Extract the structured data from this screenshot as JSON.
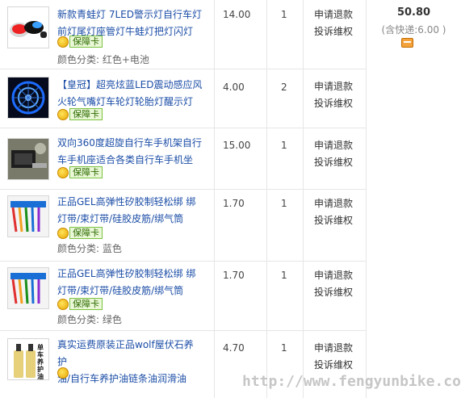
{
  "orders": [
    {
      "title": "新款青蛙灯 7LED警示灯自行车灯前灯尾灯座管灯牛蛙灯把灯闪灯",
      "title_lines": [
        "新款青蛙灯 7LED警示灯自行车灯",
        "前灯尾灯座管灯牛蛙灯把灯闪灯"
      ],
      "badge": "保障卡",
      "variant": "颜色分类: 红色+电池",
      "price": "14.00",
      "qty": "1",
      "actions": [
        "申请退款",
        "投诉维权"
      ]
    },
    {
      "title_lines": [
        "【皇冠】超亮炫蓝LED震动感应风",
        "火轮气嘴灯车轮灯轮胎灯醒示灯"
      ],
      "badge": "保障卡",
      "variant": "",
      "price": "4.00",
      "qty": "2",
      "actions": [
        "申请退款",
        "投诉维权"
      ]
    },
    {
      "title_lines": [
        "双向360度超旋自行车手机架自行",
        "车手机座适合各类自行车手机坐"
      ],
      "badge": "保障卡",
      "variant": "",
      "price": "15.00",
      "qty": "1",
      "actions": [
        "申请退款",
        "投诉维权"
      ]
    },
    {
      "title_lines": [
        "正品GEL高弹性矽胶制轻松绑 绑",
        "灯带/束灯带/硅胶皮筋/绑气筒"
      ],
      "badge": "保障卡",
      "variant": "颜色分类: 蓝色",
      "price": "1.70",
      "qty": "1",
      "actions": [
        "申请退款",
        "投诉维权"
      ]
    },
    {
      "title_lines": [
        "正品GEL高弹性矽胶制轻松绑 绑",
        "灯带/束灯带/硅胶皮筋/绑气筒"
      ],
      "badge": "保障卡",
      "variant": "颜色分类: 绿色",
      "price": "1.70",
      "qty": "1",
      "actions": [
        "申请退款",
        "投诉维权"
      ]
    },
    {
      "title_lines": [
        "真实运费原装正品wolf屋伏石养护",
        "油/自行车养护油链条油润滑油"
      ],
      "badge": "",
      "variant": "",
      "price": "4.70",
      "qty": "1",
      "actions": [
        "申请退款",
        "投诉维权"
      ]
    }
  ],
  "summary": {
    "total": "50.80",
    "shipping": "(含快递:6.00 )"
  },
  "product_image_text": "单车养护油",
  "watermark": "http://www.fengyunbike.com",
  "colors": {
    "link": "#1c4ea7",
    "border": "#e6e6e6"
  }
}
